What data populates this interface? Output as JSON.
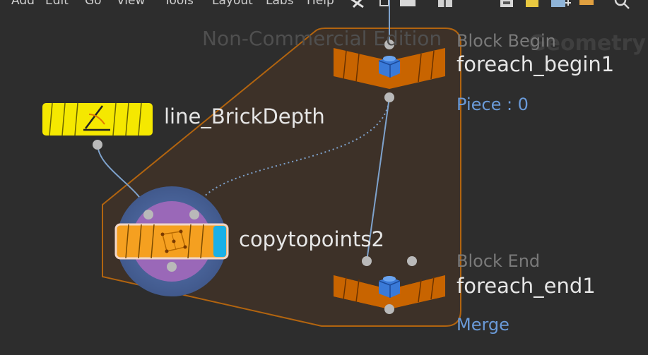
{
  "menu": [
    "Add",
    "Edit",
    "Go",
    "View",
    "Tools",
    "Layout",
    "Labs",
    "Help"
  ],
  "toolbar_icons": [
    "wrench-icon",
    "pin-icon",
    "window-icon",
    "layout-grid-icon",
    "save-icon",
    "note-icon",
    "add-network-box-icon",
    "folder-icon",
    "search-icon"
  ],
  "watermark": "Non-Commercial Edition",
  "context_label": "Geometry",
  "nodes": {
    "line": {
      "name": "line_BrickDepth",
      "color": "#f5e800",
      "icon": "line-sop-icon"
    },
    "copy": {
      "name": "copytopoints2",
      "color": "#f5a020",
      "icon": "copy-points-icon",
      "display_flag_color": "#19b0e6"
    },
    "begin": {
      "name": "foreach_begin1",
      "type_label": "Block Begin",
      "info": "Piece : 0",
      "color": "#c86400",
      "icon": "block-icon"
    },
    "end": {
      "name": "foreach_end1",
      "type_label": "Block End",
      "info": "Merge",
      "color": "#c86400",
      "icon": "block-icon"
    }
  },
  "colors": {
    "background": "#2d2d2d",
    "block_fill": "#3d3128",
    "block_outline": "#b2640f",
    "wire": "#7ea2cc",
    "port": "#b9b9b9"
  }
}
